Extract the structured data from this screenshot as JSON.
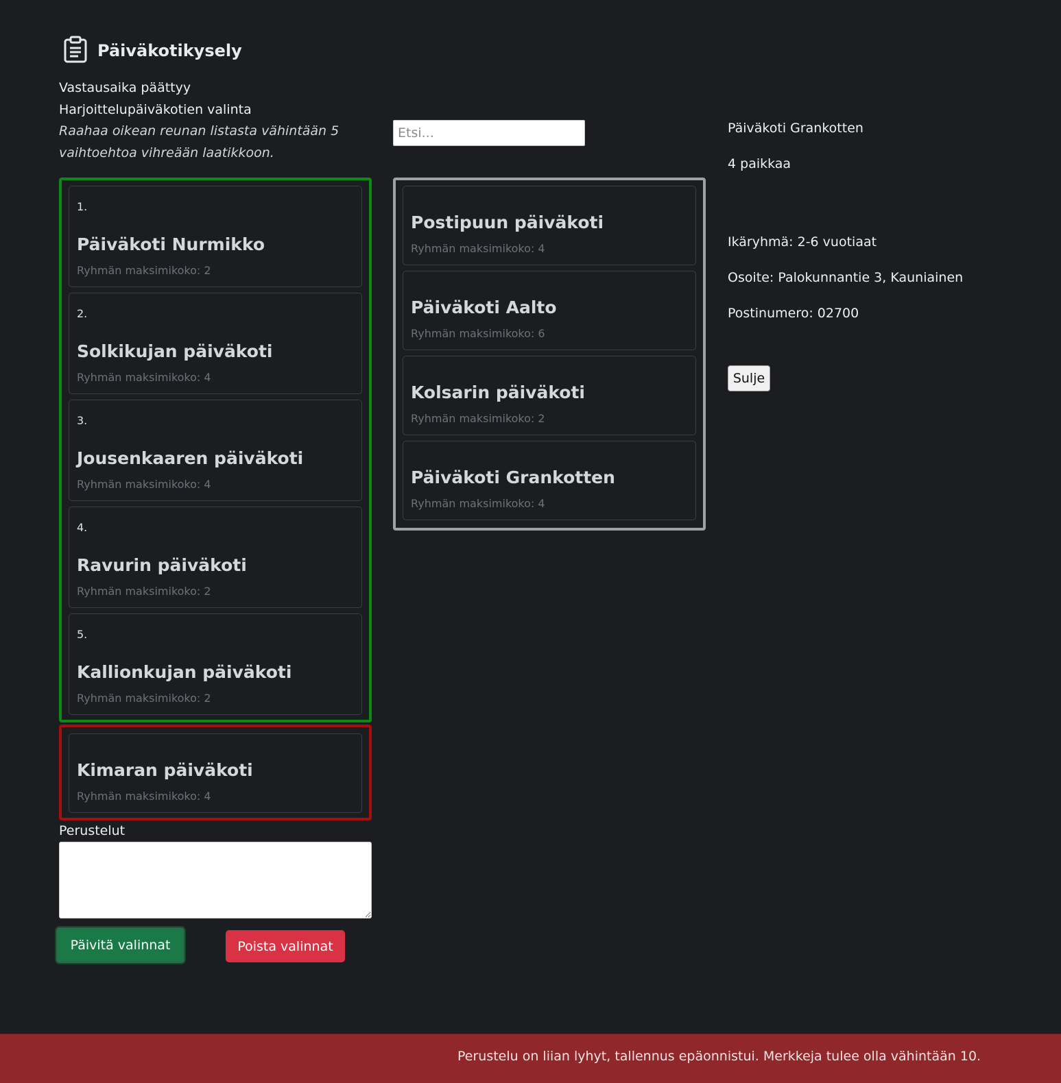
{
  "header": {
    "icon": "clipboard-icon",
    "title": "Päiväkotikysely"
  },
  "intro": {
    "deadline": "Vastausaika päättyy",
    "section": "Harjoittelupäiväkotien valinta",
    "hint": "Raahaa oikean reunan listasta vähintään 5 vaihtoehtoa vihreään laatikkoon."
  },
  "search": {
    "placeholder": "Etsi..."
  },
  "selected": [
    {
      "num": "1.",
      "name": "Päiväkoti Nurmikko",
      "size": "Ryhmän maksimikoko: 2"
    },
    {
      "num": "2.",
      "name": "Solkikujan päiväkoti",
      "size": "Ryhmän maksimikoko: 4"
    },
    {
      "num": "3.",
      "name": "Jousenkaaren päiväkoti",
      "size": "Ryhmän maksimikoko: 4"
    },
    {
      "num": "4.",
      "name": "Ravurin päiväkoti",
      "size": "Ryhmän maksimikoko: 2"
    },
    {
      "num": "5.",
      "name": "Kallionkujan päiväkoti",
      "size": "Ryhmän maksimikoko: 2"
    }
  ],
  "rejected": [
    {
      "name": "Kimaran päiväkoti",
      "size": "Ryhmän maksimikoko: 4"
    }
  ],
  "available": [
    {
      "name": "Postipuun päiväkoti",
      "size": "Ryhmän maksimikoko: 4"
    },
    {
      "name": "Päiväkoti Aalto",
      "size": "Ryhmän maksimikoko: 6"
    },
    {
      "name": "Kolsarin päiväkoti",
      "size": "Ryhmän maksimikoko: 2"
    },
    {
      "name": "Päiväkoti Grankotten",
      "size": "Ryhmän maksimikoko: 4"
    }
  ],
  "details": {
    "name": "Päiväkoti Grankotten",
    "places": "4 paikkaa",
    "age_group": "Ikäryhmä: 2-6 vuotiaat",
    "address": "Osoite: Palokunnantie 3, Kauniainen",
    "postal": "Postinumero: 02700",
    "close_label": "Sulje"
  },
  "form": {
    "perustelut_label": "Perustelut",
    "perustelut_value": "",
    "update_label": "Päivitä valinnat",
    "clear_label": "Poista valinnat"
  },
  "toast": {
    "message": "Perustelu on liian lyhyt, tallennus epäonnistui. Merkkeja tulee olla vähintään 10."
  },
  "colors": {
    "selected_border": "#0d8a14",
    "rejected_border": "#a30f0f",
    "available_border": "#9fa2a5",
    "toast_bg": "#8f272b"
  }
}
